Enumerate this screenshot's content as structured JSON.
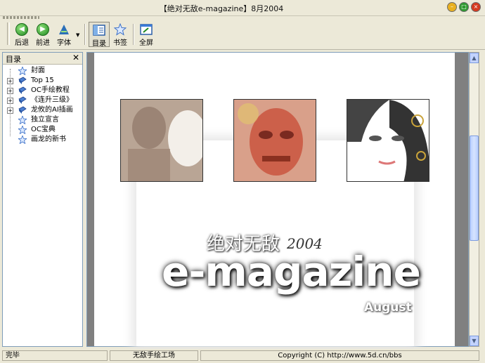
{
  "window": {
    "title": "【绝对无敌e-magazine】8月2004"
  },
  "toolbar": {
    "back_label": "后退",
    "forward_label": "前进",
    "font_label": "字体",
    "toc_label": "目录",
    "bookmark_label": "书签",
    "fullscreen_label": "全屏"
  },
  "sidebar": {
    "title": "目录",
    "close_glyph": "✕",
    "items": [
      {
        "label": "封面",
        "expandable": false
      },
      {
        "label": "Top 15",
        "expandable": true
      },
      {
        "label": "OC手绘教程",
        "expandable": true
      },
      {
        "label": "《连升三级》",
        "expandable": true
      },
      {
        "label": "龙攸的AI插画",
        "expandable": true
      },
      {
        "label": "独立宣言",
        "expandable": false
      },
      {
        "label": "OC宝典",
        "expandable": false
      },
      {
        "label": "画龙的新书",
        "expandable": false
      }
    ]
  },
  "cover": {
    "cn_title": "绝对无敌",
    "year": "2004",
    "main_title": "e-magazine",
    "month": "August"
  },
  "status": {
    "state": "完毕",
    "studio": "无敌手绘工场",
    "copyright": "Copyright (C) http://www.5d.cn/bbs"
  },
  "colors": {
    "accent": "#316AC5",
    "panel_bg": "#ECE9D8",
    "content_gray": "#808080"
  }
}
